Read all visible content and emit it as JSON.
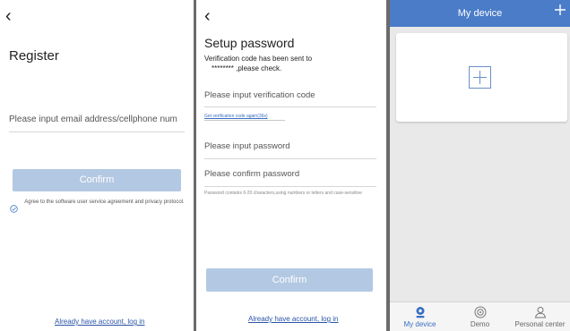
{
  "register": {
    "back_icon": "‹",
    "title": "Register",
    "email_placeholder": "Please input email address/cellphone num",
    "confirm_label": "Confirm",
    "agreement_text": "Agree to the software user service agreement and privacy protocol.",
    "login_link": "Already have account, log in"
  },
  "setup_password": {
    "back_icon": "‹",
    "title": "Setup password",
    "sent_line1": "Verification code has been sent to",
    "sent_line2": "********  ,please check.",
    "code_placeholder": "Please input verification code",
    "resend_link": "Get verification code again(36s)",
    "password_placeholder": "Please input password",
    "confirm_password_placeholder": "Please confirm password",
    "password_hint": "Password contains 6-20 characters,using numbers or letters and case-sensitive",
    "confirm_label": "Confirm",
    "login_link": "Already have account, log in"
  },
  "my_device": {
    "header_title": "My device",
    "tabs": [
      {
        "label": "My device",
        "icon": "camera-icon",
        "active": true
      },
      {
        "label": "Demo",
        "icon": "target-icon",
        "active": false
      },
      {
        "label": "Personal center",
        "icon": "person-icon",
        "active": false
      }
    ]
  },
  "colors": {
    "accent": "#4a7cc7",
    "button_disabled": "#b3c8e2",
    "link": "#2b54a8",
    "tab_active": "#3a6fc2"
  }
}
